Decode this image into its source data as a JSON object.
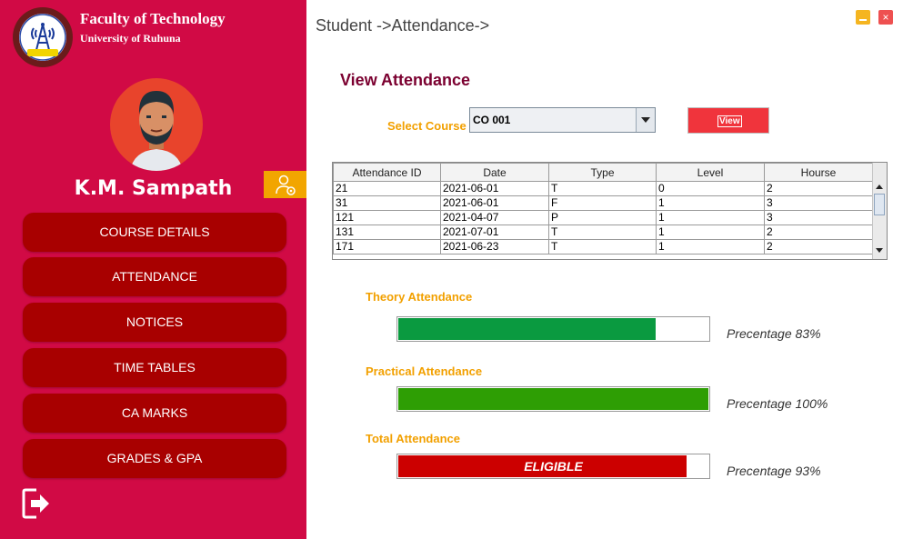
{
  "sidebar": {
    "faculty_name": "Faculty of Technology",
    "university_name": "University of Ruhuna",
    "logo_ring_text": "Faculty of Technology",
    "student_name": "K.M. Sampath",
    "nav": [
      {
        "label": "COURSE DETAILS"
      },
      {
        "label": "ATTENDANCE"
      },
      {
        "label": "NOTICES"
      },
      {
        "label": "TIME TABLES"
      },
      {
        "label": "CA MARKS"
      },
      {
        "label": "GRADES & GPA"
      }
    ],
    "icons": {
      "settings": "user-settings-icon",
      "logout": "logout-icon",
      "avatar": "student-avatar"
    }
  },
  "header": {
    "breadcrumb": "Student ->Attendance->",
    "window_controls": {
      "minimize": "minimize-icon",
      "close": "×"
    }
  },
  "main": {
    "title": "View Attendance",
    "select_label": "Select Course",
    "selected_course": "CO 001",
    "view_button": "View"
  },
  "table": {
    "columns": [
      "Attendance ID",
      "Date",
      "Type",
      "Level",
      "Hourse"
    ],
    "rows": [
      [
        "21",
        "2021-06-01",
        "T",
        "0",
        "2"
      ],
      [
        "31",
        "2021-06-01",
        "F",
        "1",
        "3"
      ],
      [
        "121",
        "2021-04-07",
        "P",
        "1",
        "3"
      ],
      [
        "131",
        "2021-07-01",
        "T",
        "1",
        "2"
      ],
      [
        "171",
        "2021-06-23",
        "T",
        "1",
        "2"
      ]
    ]
  },
  "progress": {
    "theory": {
      "label": "Theory Attendance",
      "percent": 83,
      "text": "Precentage 83%",
      "color": "#0a9a40"
    },
    "practical": {
      "label": "Practical Attendance",
      "percent": 100,
      "text": "Precentage 100%",
      "color": "#2e9e04"
    },
    "total": {
      "label": "Total Attendance",
      "percent": 93,
      "text": "Precentage 93%",
      "bar_text": "ELIGIBLE",
      "color": "#cc0000"
    }
  },
  "colors": {
    "sidebar_bg": "#d10a45",
    "nav_button": "#a80000",
    "accent_orange": "#f2a000",
    "title_maroon": "#7b0030",
    "view_button": "#f0343c"
  }
}
